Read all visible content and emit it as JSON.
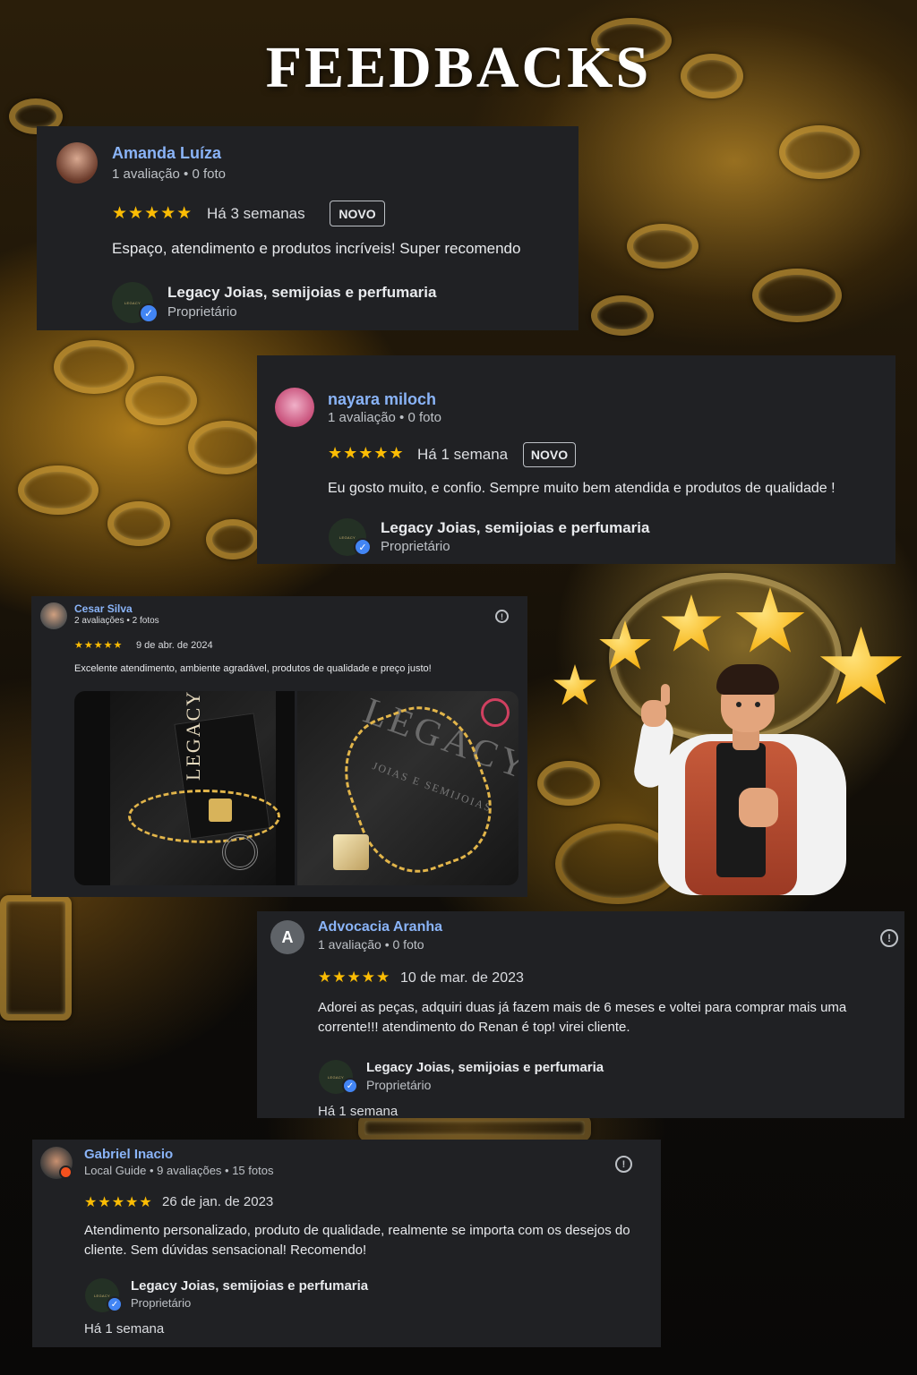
{
  "page": {
    "title": "FEEDBACKS"
  },
  "colors": {
    "card_bg": "#202124",
    "name_link": "#8ab4f8",
    "stars": "#fbbc04",
    "verified": "#4285f4"
  },
  "owner": {
    "name": "Legacy Joias, semijoias e perfumaria",
    "role": "Proprietário"
  },
  "reviews": [
    {
      "name": "Amanda Luíza",
      "meta": "1 avaliação • 0 foto",
      "stars": "★★★★★",
      "date": "Há 3 semanas",
      "badge": "NOVO",
      "text": "Espaço, atendimento e produtos incríveis! Super recomendo"
    },
    {
      "name": "nayara miloch",
      "meta": "1 avaliação • 0 foto",
      "stars": "★★★★★",
      "date": "Há 1 semana",
      "badge": "NOVO",
      "text": "Eu gosto muito, e confio. Sempre muito bem atendida e produtos de qualidade !"
    },
    {
      "name": "Cesar Silva",
      "meta": "2 avaliações • 2 fotos",
      "stars": "★★★★★",
      "date": "9 de abr. de 2024",
      "text": "Excelente atendimento, ambiente agradável, produtos de qualidade e preço justo!",
      "photo_brand": "LEGACY",
      "photo_tagline": "JOIAS E SEMIJOIAS"
    },
    {
      "name": "Advocacia Aranha",
      "avatar_letter": "A",
      "meta": "1 avaliação • 0 foto",
      "stars": "★★★★★",
      "date": "10 de mar. de 2023",
      "text": "Adorei as peças, adquiri duas já fazem mais de 6 meses e voltei para comprar mais uma corrente!!! atendimento do Renan é top! virei cliente.",
      "reply_date": "Há 1 semana"
    },
    {
      "name": "Gabriel Inacio",
      "meta": "Local Guide • 9 avaliações • 15 fotos",
      "stars": "★★★★★",
      "date": "26 de jan. de 2023",
      "text": "Atendimento personalizado, produto de qualidade, realmente se importa com os desejos do cliente. Sem dúvidas sensacional! Recomendo!",
      "reply_date": "Há 1 semana"
    }
  ],
  "icons": {
    "info": "info-icon",
    "verified": "verified-check-icon",
    "star": "star-icon"
  }
}
